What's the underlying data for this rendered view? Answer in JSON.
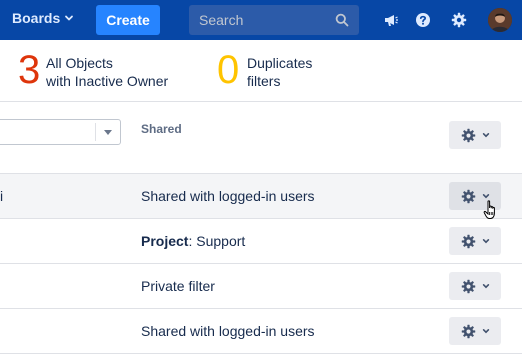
{
  "nav": {
    "boards_label": "Boards",
    "create_label": "Create",
    "search_placeholder": "Search",
    "icons": [
      "megaphone-icon",
      "help-icon",
      "gear-icon"
    ]
  },
  "stats": {
    "inactive": {
      "count": "3",
      "label_line1": "All Objects",
      "label_line2": "with Inactive Owner",
      "color": "#de350b"
    },
    "duplicates": {
      "count": "0",
      "label_line1": "Duplicates",
      "label_line2": "filters",
      "color": "#ffc400"
    }
  },
  "table": {
    "header_shared": "Shared",
    "rows": [
      {
        "edge_text": "i",
        "shared": "Shared with logged-in users"
      },
      {
        "shared_prefix": "Project",
        "shared_suffix": ": Support"
      },
      {
        "shared": "Private filter"
      },
      {
        "shared": "Shared with logged-in users"
      }
    ]
  },
  "colors": {
    "nav_bg": "#0747a6",
    "create_bg": "#2684ff",
    "hover_row": "#f4f5f7"
  }
}
